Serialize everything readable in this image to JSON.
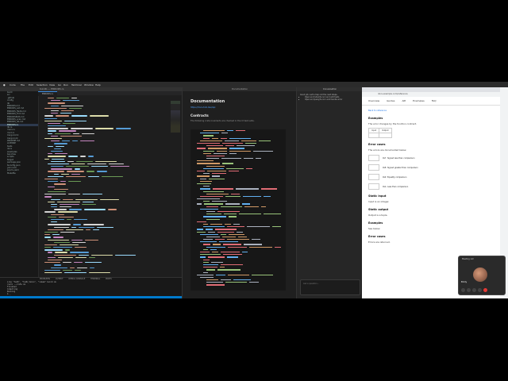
{
  "menubar": {
    "app": "Code",
    "items": [
      "File",
      "Edit",
      "Selection",
      "View",
      "Go",
      "Run",
      "Terminal",
      "Window",
      "Help"
    ]
  },
  "editor": {
    "title": "tokidb — ERRORS.rs",
    "tab": "ERRORS.rs",
    "explorer": [
      "build",
      "src",
      ".github",
      "config",
      "lib",
      "ERRORS.md",
      "ERRORS_ext.md",
      "ERRORS_ftsdb.md",
      "ERRORS_Fmt.md",
      "ERRORSPath.md",
      "ERRORS_scan.md",
      "ERRORS_db.md",
      "ERRORS.rs",
      "lib.rs",
      "main.rs",
      "mod.rs",
      "Cargo.toml",
      "Cargo.lock",
      "README.md",
      "LICENSE",
      "tests",
      "docs",
      "examples",
      "benches",
      "scripts",
      "target",
      "package.json",
      "tsconfig.json",
      "yarn.lock",
      "pnpm.yaml",
      "Makefile"
    ],
    "terminal_tabs": [
      "PROBLEMS",
      "OUTPUT",
      "DEBUG CONSOLE",
      "TERMINAL",
      "PORTS"
    ],
    "terminal_lines": [
      "Line \"tsdb\", \"tsdb_tokio\", \"inmem\" build ok",
      "rustc --crate ok",
      "Finished",
      "Compiling",
      "Running",
      "$ _"
    ]
  },
  "docs": {
    "header": "Documentation",
    "title": "Documentation",
    "link": "https://docs.toki.dev/api",
    "contracts_title": "Contracts",
    "contracts_text": "The following crate invariants are checked in the CI test suite."
  },
  "assistant": {
    "header": "Conversation",
    "message_intro": "Good job. Let's map out the next steps.",
    "bullets": [
      "Open src/index/ts.rs:1 and add tests",
      "Open src/query/ts.rs:1 and handle error"
    ],
    "input_placeholder": "Ask a question..."
  },
  "browser": {
    "url": "docs.example.com/reference",
    "nav": [
      "Overview",
      "Guides",
      "API",
      "Examples",
      "FAQ"
    ],
    "sections": [
      {
        "heading": "Examples",
        "text": "The error changes by the function contract."
      },
      {
        "heading": "Error cases",
        "text": "The errors are documented below."
      },
      {
        "heading": "Static input",
        "text": "Input is an integer."
      },
      {
        "heading": "Static output",
        "text": "Output is a tuple."
      },
      {
        "heading": "Examples",
        "text": "See below."
      },
      {
        "heading": "Error cases",
        "text": "Errors are returned."
      }
    ],
    "rows": [
      {
        "code": "0x7",
        "label": "Signed less than comparison"
      },
      {
        "code": "0x8",
        "label": "Signed greater than comparison"
      },
      {
        "code": "0x9",
        "label": "Equality comparison"
      },
      {
        "code": "0xA",
        "label": "Less than comparison"
      }
    ],
    "table_headers": [
      "Input",
      "Output"
    ],
    "link_text": "Back to reference"
  },
  "call": {
    "title": "Meeting call",
    "participant": "Emily"
  },
  "colors": {
    "accent": "#007acc",
    "link": "#1a73e8",
    "end_call": "#e53935"
  }
}
